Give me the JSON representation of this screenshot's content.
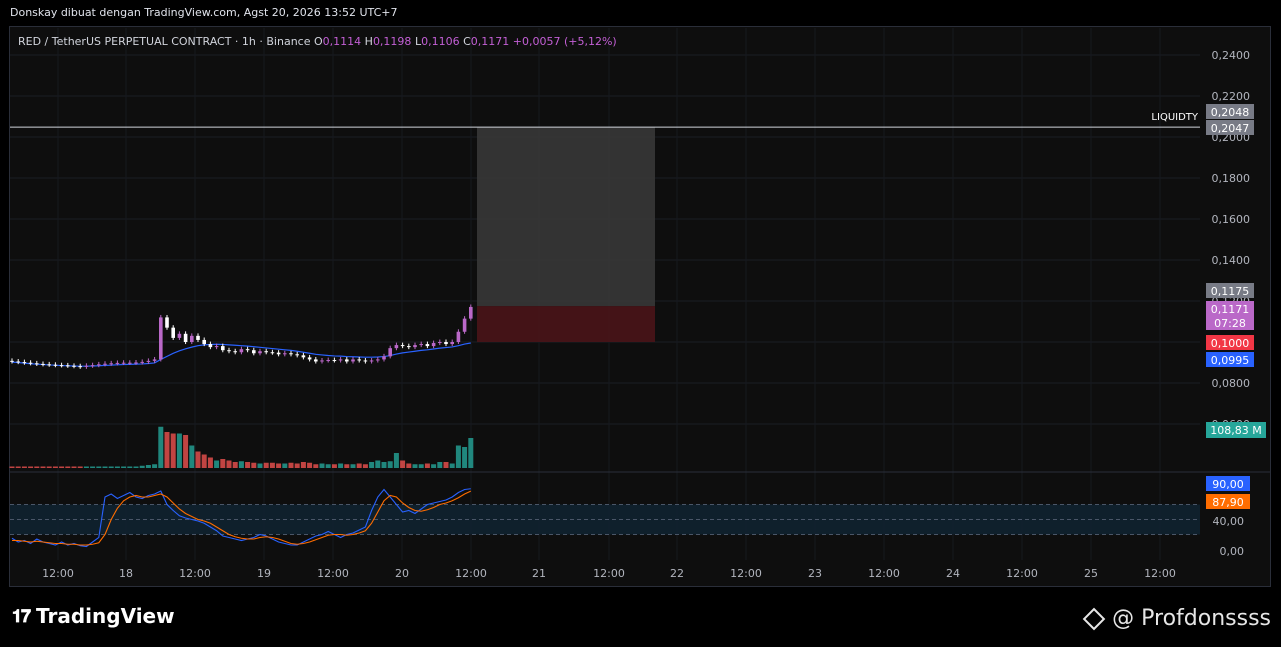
{
  "header": {
    "text": "Donskay dibuat dengan TradingView.com, Agst 20, 2026 13:52 UTC+7"
  },
  "legend": {
    "symbol": "RED / TetherUS PERPETUAL CONTRACT · 1h · Binance",
    "o_label": "O",
    "o": "0,1114",
    "h_label": "H",
    "h": "0,1198",
    "l_label": "L",
    "l": "0,1106",
    "c_label": "C",
    "c": "0,1171",
    "change": "+0,0057 (+5,12%)"
  },
  "colors": {
    "up": "#ba68c8",
    "down": "#ffffff",
    "vol_up": "#26a69a",
    "vol_down": "#ef5350",
    "ma": "#2962ff",
    "rsi": "#2962ff",
    "rsi_ma": "#ff6d00"
  },
  "chart_data": {
    "type": "line",
    "y_ticks": [
      "0,2400",
      "0,2200",
      "0,2000",
      "0,1800",
      "0,1600",
      "0,1400",
      "0,1200",
      "0,1000",
      "0,0800",
      "0,0600"
    ],
    "ylim": [
      0.06,
      0.25
    ],
    "x_ticks": [
      "12:00",
      "18",
      "12:00",
      "19",
      "12:00",
      "20",
      "12:00",
      "21",
      "12:00",
      "22",
      "12:00",
      "23",
      "12:00",
      "24",
      "12:00",
      "25",
      "12:00"
    ],
    "price_labels": [
      {
        "text": "0,2048",
        "value": 0.2048,
        "color": "#787b86"
      },
      {
        "text": "0,2047",
        "value": 0.2047,
        "color": "#787b86"
      },
      {
        "text": "0,1175",
        "value": 0.1175,
        "color": "#787b86"
      },
      {
        "text": "0,1171",
        "value": 0.1171,
        "color": "#ba68c8"
      },
      {
        "text": "07:28",
        "value": 0.1171,
        "color": "#ba68c8"
      },
      {
        "text": "0,1000",
        "value": 0.1,
        "color": "#f23645"
      },
      {
        "text": "0,0995",
        "value": 0.0995,
        "color": "#2962ff"
      }
    ],
    "volume_label": "108,83 M",
    "liquidity": {
      "text": "LIQUIDTY",
      "value": 0.2048
    },
    "position_box": {
      "entry": 0.1175,
      "target": 0.2048,
      "stop": 0.1
    },
    "close": [
      0.0905,
      0.0902,
      0.0899,
      0.0896,
      0.0893,
      0.0891,
      0.0889,
      0.0887,
      0.0886,
      0.0884,
      0.0882,
      0.0879,
      0.0884,
      0.0887,
      0.0891,
      0.0894,
      0.0896,
      0.0898,
      0.0899,
      0.0899,
      0.09,
      0.0903,
      0.0908,
      0.0915,
      0.112,
      0.107,
      0.102,
      0.104,
      0.1,
      0.103,
      0.101,
      0.099,
      0.0975,
      0.098,
      0.096,
      0.0955,
      0.095,
      0.0965,
      0.096,
      0.0945,
      0.0955,
      0.095,
      0.0948,
      0.094,
      0.0945,
      0.094,
      0.0935,
      0.0925,
      0.0915,
      0.0905,
      0.091,
      0.0912,
      0.091,
      0.0915,
      0.0905,
      0.0915,
      0.091,
      0.0905,
      0.091,
      0.0915,
      0.093,
      0.097,
      0.0985,
      0.098,
      0.0975,
      0.0985,
      0.099,
      0.098,
      0.0995,
      0.1,
      0.099,
      0.1,
      0.105,
      0.1114,
      0.1171
    ],
    "open": [
      0.0908,
      0.0905,
      0.0902,
      0.0899,
      0.0896,
      0.0893,
      0.0891,
      0.0889,
      0.0887,
      0.0886,
      0.0884,
      0.0882,
      0.0879,
      0.0884,
      0.0887,
      0.0891,
      0.0894,
      0.0896,
      0.0898,
      0.0899,
      0.0899,
      0.09,
      0.0903,
      0.0908,
      0.0915,
      0.112,
      0.107,
      0.102,
      0.104,
      0.1,
      0.103,
      0.101,
      0.099,
      0.0975,
      0.098,
      0.096,
      0.0955,
      0.095,
      0.0965,
      0.096,
      0.0945,
      0.0955,
      0.095,
      0.0948,
      0.094,
      0.0945,
      0.094,
      0.0935,
      0.0925,
      0.0915,
      0.0905,
      0.091,
      0.0912,
      0.091,
      0.0915,
      0.0905,
      0.0915,
      0.091,
      0.0905,
      0.091,
      0.0915,
      0.093,
      0.097,
      0.0985,
      0.098,
      0.0975,
      0.0985,
      0.099,
      0.098,
      0.0995,
      0.1,
      0.099,
      0.1,
      0.105,
      0.1114
    ],
    "ma": [
      0.0902,
      0.09,
      0.0897,
      0.0894,
      0.0892,
      0.089,
      0.0888,
      0.0887,
      0.0885,
      0.0884,
      0.0883,
      0.0882,
      0.0882,
      0.0883,
      0.0884,
      0.0886,
      0.0887,
      0.0889,
      0.089,
      0.0891,
      0.0892,
      0.0893,
      0.0895,
      0.0898,
      0.0915,
      0.093,
      0.0945,
      0.0957,
      0.0967,
      0.0975,
      0.0982,
      0.0986,
      0.0988,
      0.0989,
      0.0988,
      0.0986,
      0.0984,
      0.0982,
      0.098,
      0.0977,
      0.0974,
      0.0971,
      0.0968,
      0.0965,
      0.0962,
      0.0959,
      0.0955,
      0.095,
      0.0945,
      0.094,
      0.0937,
      0.0934,
      0.0932,
      0.0931,
      0.0929,
      0.0928,
      0.0927,
      0.0926,
      0.0926,
      0.0927,
      0.0929,
      0.0934,
      0.0941,
      0.0947,
      0.0951,
      0.0955,
      0.0959,
      0.0962,
      0.0966,
      0.097,
      0.0973,
      0.0976,
      0.0982,
      0.099,
      0.0995
    ],
    "volume": [
      2,
      2,
      2,
      2,
      2,
      2,
      2,
      2,
      2,
      2,
      2,
      2,
      2,
      2,
      2,
      2,
      2,
      2,
      2,
      2,
      2,
      3,
      4,
      5,
      55,
      48,
      46,
      46,
      44,
      30,
      22,
      18,
      14,
      10,
      12,
      10,
      8,
      9,
      8,
      7,
      6,
      7,
      7,
      6,
      6,
      7,
      6,
      8,
      7,
      5,
      6,
      5,
      5,
      6,
      5,
      5,
      6,
      5,
      8,
      10,
      8,
      9,
      20,
      10,
      6,
      5,
      5,
      6,
      5,
      8,
      8,
      6,
      30,
      28,
      40
    ],
    "rsi": [
      25,
      20,
      22,
      18,
      24,
      20,
      18,
      16,
      20,
      16,
      18,
      15,
      14,
      20,
      26,
      80,
      84,
      78,
      82,
      86,
      80,
      78,
      82,
      84,
      88,
      70,
      62,
      55,
      52,
      50,
      48,
      45,
      40,
      35,
      28,
      26,
      24,
      22,
      24,
      26,
      30,
      28,
      24,
      20,
      18,
      16,
      16,
      20,
      24,
      28,
      30,
      34,
      30,
      26,
      30,
      32,
      36,
      40,
      62,
      80,
      90,
      80,
      70,
      60,
      62,
      58,
      64,
      70,
      72,
      74,
      76,
      80,
      86,
      90,
      91
    ],
    "rsi_ma": [
      22,
      22,
      21,
      20,
      21,
      20,
      19,
      18,
      18,
      17,
      17,
      16,
      16,
      17,
      19,
      30,
      50,
      65,
      75,
      80,
      82,
      80,
      80,
      82,
      84,
      80,
      72,
      64,
      58,
      54,
      50,
      48,
      45,
      40,
      35,
      30,
      27,
      25,
      24,
      24,
      26,
      27,
      26,
      24,
      21,
      18,
      17,
      18,
      20,
      23,
      26,
      29,
      30,
      30,
      29,
      30,
      32,
      35,
      45,
      60,
      75,
      82,
      80,
      72,
      66,
      62,
      61,
      63,
      66,
      70,
      72,
      75,
      79,
      84,
      87.9
    ],
    "rsi_labels": [
      {
        "text": "90,00",
        "value": 90,
        "color": "#2962ff"
      },
      {
        "text": "87,90",
        "value": 87.9,
        "color": "#ff6d00"
      }
    ],
    "rsi_ticks": [
      {
        "text": "40,00",
        "value": 40
      },
      {
        "text": "0,00",
        "value": 0
      }
    ]
  },
  "footer": {
    "brand": "TradingView",
    "handle": "@ Profdonssss"
  }
}
